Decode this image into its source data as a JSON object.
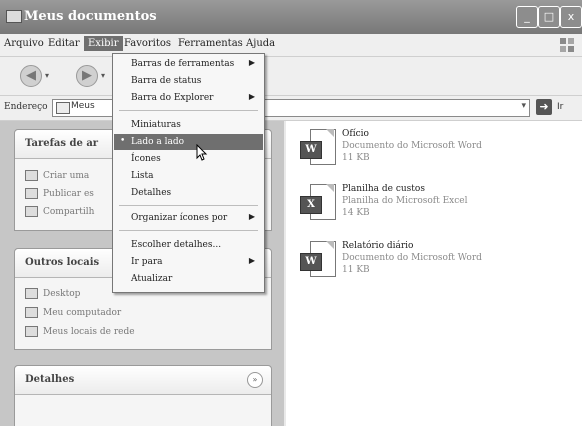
{
  "window": {
    "title": "Meus documentos"
  },
  "title_buttons": {
    "minimize": "_",
    "maximize": "□",
    "close": "x"
  },
  "menubar": {
    "items": [
      "Arquivo",
      "Editar",
      "Exibir",
      "Favoritos",
      "Ferramentas",
      "Ajuda"
    ],
    "active": "Exibir"
  },
  "toolbar": {
    "back_glyph": "◀",
    "forward_glyph": "▶",
    "drop_glyph": "▾"
  },
  "address": {
    "label": "Endereço",
    "value": "Meus",
    "go_label": "Ir",
    "go_glyph": "➜",
    "drop_glyph": "▾"
  },
  "left_pane": {
    "tasks_panel": {
      "title": "Tarefas de ar",
      "items": [
        "Criar uma",
        "Publicar es",
        "Compartilh"
      ]
    },
    "other_places_panel": {
      "title": "Outros locais",
      "items": [
        "Desktop",
        "Meu computador",
        "Meus locais de rede"
      ]
    },
    "details_panel": {
      "title": "Detalhes"
    },
    "chevron_glyph": "»"
  },
  "files": [
    {
      "name": "Ofício",
      "type": "Documento do Microsoft Word",
      "size": "11 KB",
      "badge": "W",
      "icon": "word-document-icon"
    },
    {
      "name": "Planilha de custos",
      "type": "Planilha do Microsoft Excel",
      "size": "14 KB",
      "badge": "X",
      "icon": "excel-spreadsheet-icon"
    },
    {
      "name": "Relatório diário",
      "type": "Documento do Microsoft Word",
      "size": "11 KB",
      "badge": "W",
      "icon": "word-document-icon"
    }
  ],
  "exibir_menu": {
    "items": [
      {
        "label": "Barras de ferramentas",
        "submenu": true
      },
      {
        "label": "Barra de status",
        "submenu": false
      },
      {
        "label": "Barra do Explorer",
        "submenu": true
      },
      {
        "label": "Miniaturas",
        "submenu": false
      },
      {
        "label": "Lado a lado",
        "submenu": false,
        "selected": true,
        "highlighted": true
      },
      {
        "label": "Ícones",
        "submenu": false
      },
      {
        "label": "Lista",
        "submenu": false
      },
      {
        "label": "Detalhes",
        "submenu": false
      },
      {
        "label": "Organizar ícones por",
        "submenu": true
      },
      {
        "label": "Escolher detalhes...",
        "submenu": false
      },
      {
        "label": "Ir para",
        "submenu": true
      },
      {
        "label": "Atualizar",
        "submenu": false
      }
    ],
    "arrow_glyph": "▶",
    "bullet_glyph": "•"
  }
}
